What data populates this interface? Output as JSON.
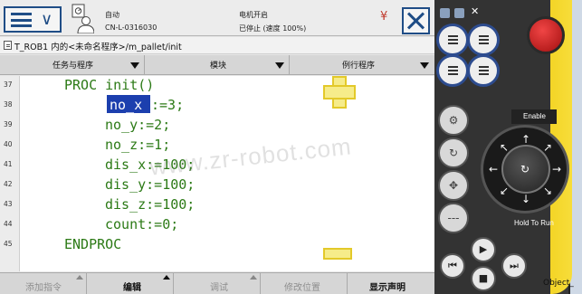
{
  "topbar": {
    "mode": "自动",
    "station": "CN-L-0316030",
    "motors": "电机开启",
    "run_state": "已停止 (速度 100%)"
  },
  "path": "T_ROB1 内的<未命名程序>/m_pallet/init",
  "tabs": [
    {
      "label": "任务与程序"
    },
    {
      "label": "模块"
    },
    {
      "label": "例行程序"
    }
  ],
  "code": {
    "lines": [
      {
        "n": "37",
        "text": "PROC init()"
      },
      {
        "n": "38",
        "text": ":=3;"
      },
      {
        "n": "39",
        "text": "no_y:=2;"
      },
      {
        "n": "40",
        "text": "no_z:=1;"
      },
      {
        "n": "41",
        "text": "dis_x:=100;"
      },
      {
        "n": "42",
        "text": "dis_y:=100;"
      },
      {
        "n": "43",
        "text": "dis_z:=100;"
      },
      {
        "n": "44",
        "text": "count:=0;"
      },
      {
        "n": "45",
        "text": "ENDPROC"
      }
    ],
    "selected_token": "no_x"
  },
  "watermark": "www.zr-robot.com",
  "bottom_buttons": [
    {
      "label": "添加指令",
      "enabled": false
    },
    {
      "label": "编辑",
      "enabled": true
    },
    {
      "label": "调试",
      "enabled": false
    },
    {
      "label": "修改位置",
      "enabled": false
    },
    {
      "label": "显示声明",
      "enabled": true
    }
  ],
  "panel": {
    "enable_label": "Enable",
    "hold_to_run_label": "Hold To Run",
    "object_label": "Object_"
  },
  "colors": {
    "accent": "#1f4d86",
    "code": "#2c7a16",
    "selection": "#1c3fae",
    "plus_minus": "#f6ec8a"
  }
}
